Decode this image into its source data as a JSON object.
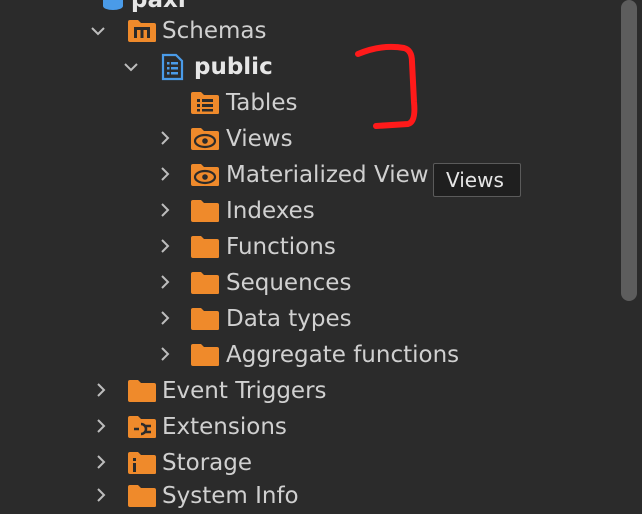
{
  "tree": {
    "top_partial": "paxi",
    "schemas": "Schemas",
    "public": "public",
    "tables": "Tables",
    "views": "Views",
    "materialized_views": "Materialized View",
    "indexes": "Indexes",
    "functions": "Functions",
    "sequences": "Sequences",
    "data_types": "Data types",
    "aggregate_functions": "Aggregate functions",
    "event_triggers": "Event Triggers",
    "extensions": "Extensions",
    "storage": "Storage",
    "bottom_partial": "System Info"
  },
  "tooltip": "Views",
  "colors": {
    "folder": "#ef8a2b",
    "db_icon": "#4a9be8",
    "annotation": "#ff1a1a",
    "background": "#2b2b2b"
  }
}
